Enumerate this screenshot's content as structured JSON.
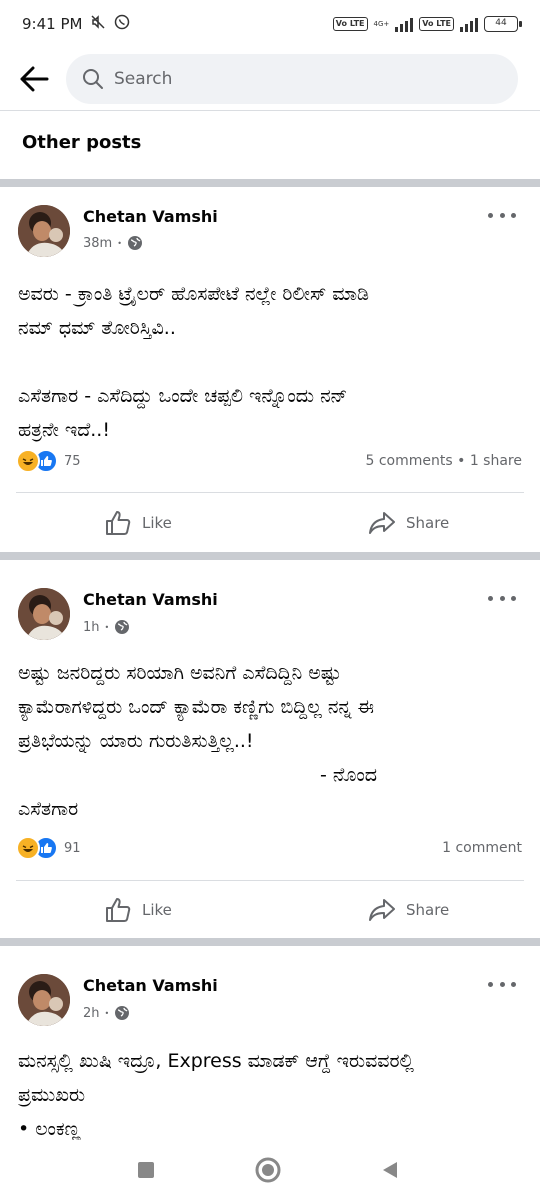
{
  "status_bar": {
    "time": "9:41 PM",
    "volte1": "Vo LTE",
    "net": "4G+",
    "volte2": "Vo LTE",
    "battery": "44"
  },
  "search": {
    "placeholder": "Search"
  },
  "section_title": "Other posts",
  "posts": [
    {
      "author": "Chetan Vamshi",
      "time": "38m",
      "text": "ಅವರು - ಕ್ರಾಂತಿ ಟ್ರೈಲರ್ ಹೊಸಪೇಟೆ ನಲ್ಲೇ ರಿಲೀಸ್ ಮಾಡಿ\nನಮ್ ಧಮ್ ತೋರಿಸ್ತಿವಿ..\n\nಎಸೆತಗಾರ - ಎಸೆದಿದ್ದು ಒಂದೇ ಚಪ್ಪಲಿ ಇನ್ನೊಂದು ನನ್\nಹತ್ರನೇ ಇದೆ..!",
      "reaction_count": "75",
      "stats": "5 comments • 1 share",
      "like_label": "Like",
      "share_label": "Share"
    },
    {
      "author": "Chetan Vamshi",
      "time": "1h",
      "text": "ಅಷ್ಟು ಜನರಿದ್ದರು ಸರಿಯಾಗಿ ಅವನಿಗೆ ಎಸೆದಿದ್ದಿನಿ ಅಷ್ಟು\nಕ್ಯಾಮೆರಾಗಳಿದ್ದರು ಒಂದ್ ಕ್ಯಾಮೆರಾ ಕಣ್ಣಿಗು ಬಿದ್ದಿಲ್ಲ ನನ್ನ ಈ\nಪ್ರತಿಭೆಯನ್ನು ಯಾರು ಗುರುತಿಸುತ್ತಿಲ್ಲ..!\n                                                  - ನೊಂದ\nಎಸೆತಗಾರ",
      "reaction_count": "91",
      "stats": "1 comment",
      "like_label": "Like",
      "share_label": "Share"
    },
    {
      "author": "Chetan Vamshi",
      "time": "2h",
      "text": "ಮನಸ್ಸಲ್ಲಿ ಖುಷಿ ಇದ್ರೂ, Express ಮಾಡಕ್ ಆಗ್ದೆ ಇರುವವರಲ್ಲಿ\nಪ್ರಮುಖರು\n• ಲಂಕಣ್ಣ"
    }
  ],
  "colors": {
    "accent": "#1877f2",
    "separator": "#c9ccd1",
    "secondary_text": "#65676b",
    "haha": "#f7b125"
  }
}
